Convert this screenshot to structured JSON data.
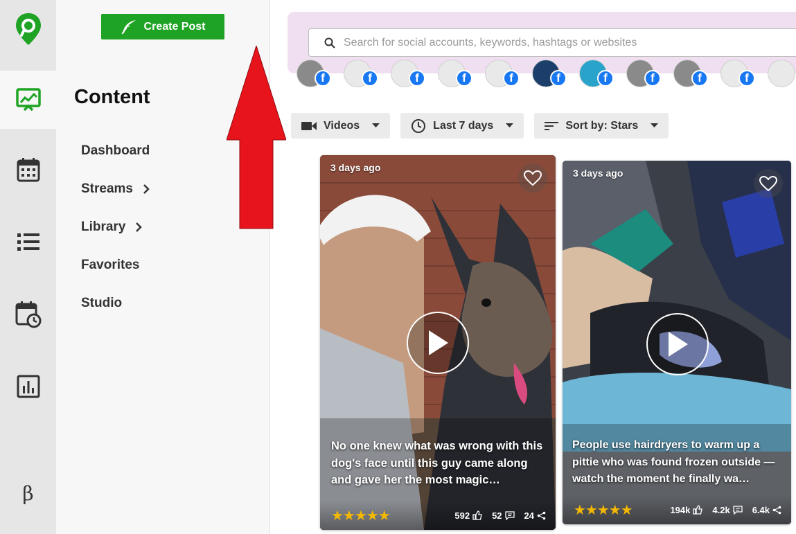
{
  "sidebar": {
    "create_post_label": "Create Post",
    "title": "Content",
    "nav": [
      {
        "label": "Dashboard"
      },
      {
        "label": "Streams"
      },
      {
        "label": "Library"
      },
      {
        "label": "Favorites"
      },
      {
        "label": "Studio"
      }
    ],
    "beta_label": "β"
  },
  "search": {
    "placeholder": "Search for social accounts, keywords, hashtags or websites"
  },
  "filters": {
    "type_label": "Videos",
    "range_label": "Last 7 days",
    "sort_label": "Sort by: Stars"
  },
  "posts": [
    {
      "age": "3 days ago",
      "caption": "No one knew what was wrong with this dog's face until this guy came along and gave her the most magic…",
      "rating_stars": "★★★★★",
      "likes": "592",
      "comments": "52",
      "shares": "24"
    },
    {
      "age": "3 days ago",
      "caption": "People use hairdryers to warm up a pittie who was found frozen outside — watch the moment he finally wa…",
      "rating_stars": "★★★★★",
      "likes": "194k",
      "comments": "4.2k",
      "shares": "6.4k"
    }
  ],
  "colors": {
    "brand_green": "#1fa324",
    "annotation_red": "#e8141c",
    "search_band": "#f0dff1",
    "facebook_blue": "#1877f2",
    "star_gold": "#f5b800"
  },
  "icons": {
    "logo": "location-pin-logo-icon",
    "rail": [
      "content-icon",
      "calendar-icon",
      "list-icon",
      "scheduled-icon",
      "analytics-icon"
    ]
  }
}
